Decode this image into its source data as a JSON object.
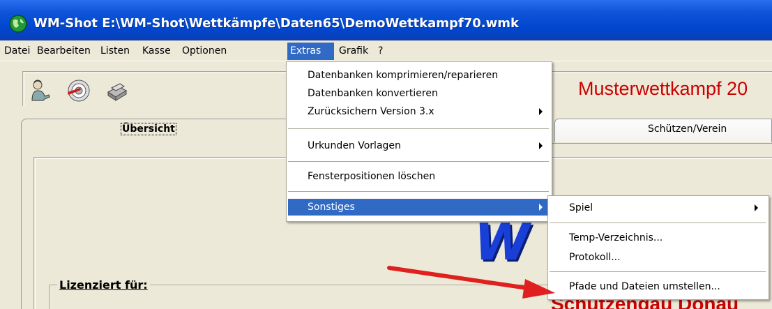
{
  "window": {
    "title": "WM-Shot E:\\WM-Shot\\Wettkämpfe\\Daten65\\DemoWettkampf70.wmk"
  },
  "menubar": {
    "items": [
      {
        "label": "Datei"
      },
      {
        "label": "Bearbeiten"
      },
      {
        "label": "Listen"
      },
      {
        "label": "Kasse"
      },
      {
        "label": "Optionen"
      },
      {
        "label": "Extras",
        "active": true
      },
      {
        "label": "Grafik"
      },
      {
        "label": "?"
      }
    ]
  },
  "toolbar": {
    "buttons": [
      {
        "icon": "shooter-icon"
      },
      {
        "icon": "target-icon"
      },
      {
        "icon": "money-icon"
      }
    ]
  },
  "competition_title": "Musterwettkampf 20",
  "tabs": [
    {
      "label": "Übersicht",
      "active": true
    },
    {
      "label": "Schützen/Verein"
    }
  ],
  "panel": {
    "logo_text": "W",
    "group_label": "Lizenziert für:",
    "licensee_partial": "Schützengau Donau"
  },
  "extras_menu": {
    "items": [
      {
        "label": "Datenbanken komprimieren/reparieren"
      },
      {
        "label": "Datenbanken konvertieren"
      },
      {
        "label": "Zurücksichern Version 3.x",
        "submenu": true
      },
      {
        "label": "Urkunden Vorlagen",
        "submenu": true
      },
      {
        "label": "Fensterpositionen löschen"
      },
      {
        "label": "Sonstiges",
        "submenu": true,
        "highlighted": true
      }
    ]
  },
  "sonstiges_menu": {
    "items": [
      {
        "label": "Spiel",
        "submenu": true
      },
      {
        "label": "Temp-Verzeichnis..."
      },
      {
        "label": "Protokoll..."
      },
      {
        "label": "Pfade und Dateien umstellen..."
      }
    ]
  },
  "colors": {
    "titlebar": "#0046cf",
    "highlight": "#316ac5",
    "accent_red": "#cc0000",
    "logo_blue": "#1a3fd6"
  }
}
